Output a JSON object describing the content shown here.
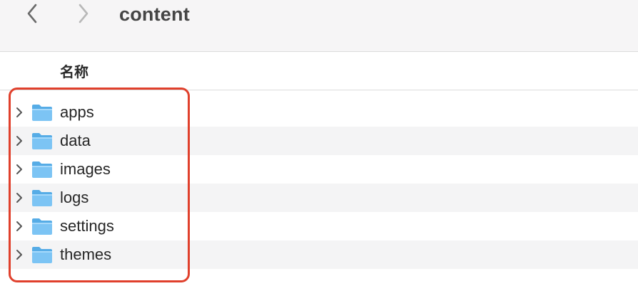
{
  "window": {
    "title": "content"
  },
  "toolbar": {
    "back_icon": "chevron-left-icon",
    "forward_icon": "chevron-right-icon"
  },
  "columns": {
    "name_label": "名称"
  },
  "items": [
    {
      "label": "apps",
      "icon": "folder-icon",
      "expander": "chevron-right-icon"
    },
    {
      "label": "data",
      "icon": "folder-icon",
      "expander": "chevron-right-icon"
    },
    {
      "label": "images",
      "icon": "folder-icon",
      "expander": "chevron-right-icon"
    },
    {
      "label": "logs",
      "icon": "folder-icon",
      "expander": "chevron-right-icon"
    },
    {
      "label": "settings",
      "icon": "folder-icon",
      "expander": "chevron-right-icon"
    },
    {
      "label": "themes",
      "icon": "folder-icon",
      "expander": "chevron-right-icon"
    }
  ],
  "colors": {
    "folder_body": "#7cc4f4",
    "folder_tab": "#56ace6",
    "highlight_border": "#e0402c",
    "alt_row_bg": "#f4f4f5"
  }
}
